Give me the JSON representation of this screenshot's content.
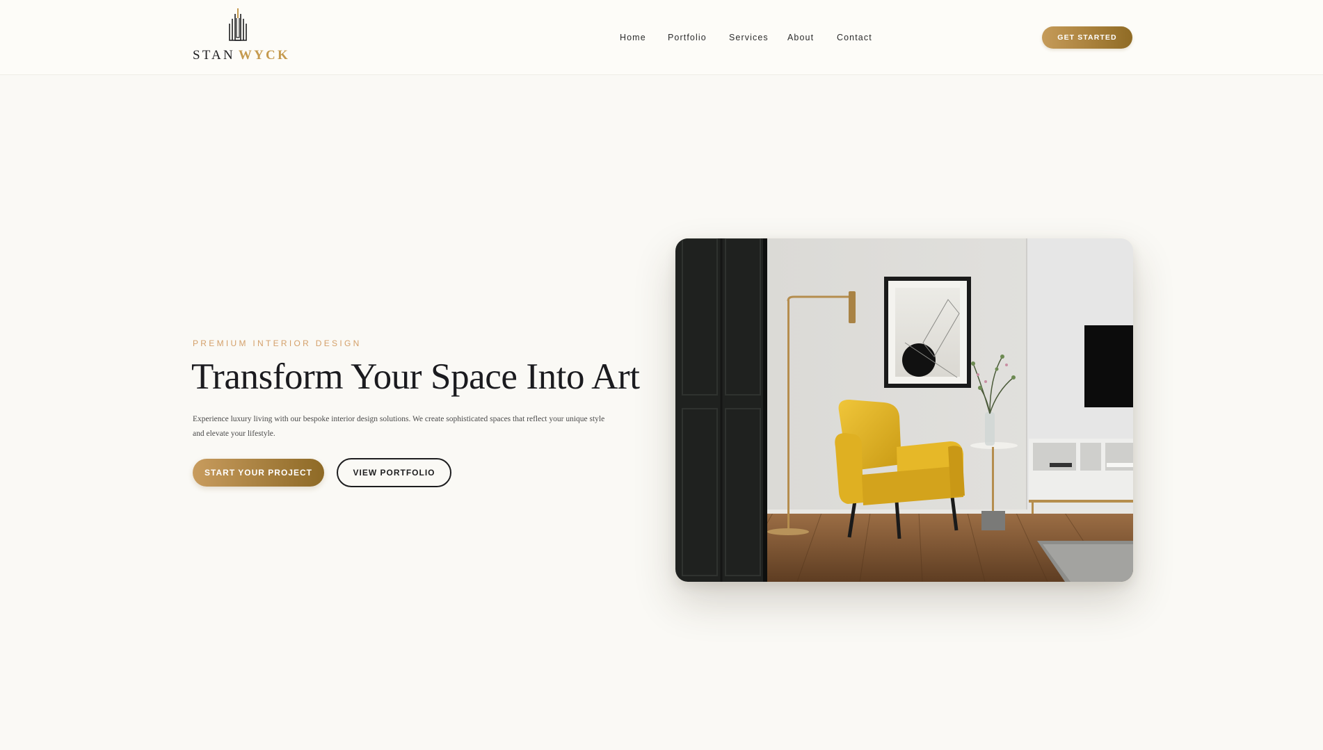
{
  "brand": {
    "logo_part1": "STAN",
    "logo_part2": "WYCK",
    "primary_color": "#1d1d1f",
    "accent_color": "#c59a4e"
  },
  "nav": {
    "items": [
      {
        "label": "Home"
      },
      {
        "label": "Portfolio"
      },
      {
        "label": "Services"
      },
      {
        "label": "About"
      },
      {
        "label": "Contact"
      }
    ],
    "cta_label": "GET STARTED"
  },
  "hero": {
    "eyebrow": "PREMIUM INTERIOR DESIGN",
    "title": "Transform Your Space Into Art",
    "description": "Experience luxury living with our bespoke interior design solutions. We create sophisticated spaces that reflect your unique style and elevate your lifestyle.",
    "primary_button": "START YOUR PROJECT",
    "secondary_button": "VIEW PORTFOLIO",
    "image_subject": "interior-living-room-yellow-armchair"
  },
  "colors": {
    "background": "#faf9f5",
    "gold_gradient_start": "#c59b59",
    "gold_gradient_end": "#8f6b25",
    "eyebrow": "#d4a06a"
  }
}
